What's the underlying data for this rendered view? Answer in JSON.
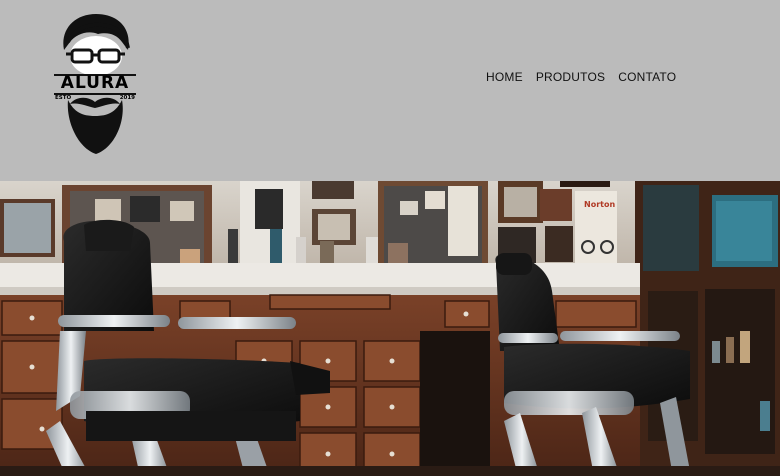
{
  "brand": {
    "name": "ALURA",
    "est_label": "ESTO",
    "est_year": "2019"
  },
  "nav": {
    "items": [
      {
        "label": "HOME"
      },
      {
        "label": "PRODUTOS"
      },
      {
        "label": "CONTATO"
      }
    ]
  },
  "hero": {
    "image": "barbershop-interior-photo",
    "poster_text": "Norton"
  },
  "colors": {
    "header_bg": "#bbbbbb",
    "nav_text": "#111111"
  }
}
